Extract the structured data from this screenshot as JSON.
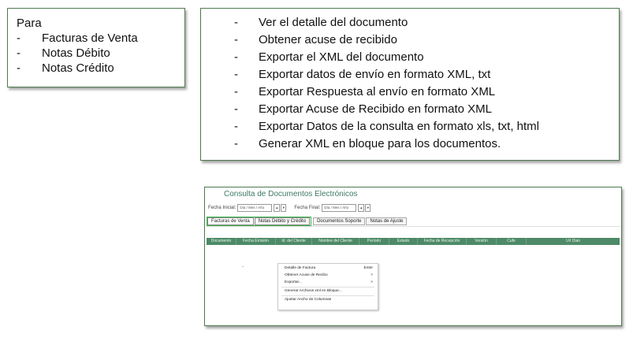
{
  "left_box": {
    "intro": "Para",
    "items": [
      "Facturas de Venta",
      "Notas Débito",
      "Notas Crédito"
    ]
  },
  "right_box": {
    "items": [
      "Ver el detalle del documento",
      "Obtener acuse de recibido",
      "Exportar el XML del documento",
      "Exportar datos de envío en formato XML, txt",
      "Exportar Respuesta al envío en formato XML",
      "Exportar Acuse de Recibido en formato XML",
      "Exportar Datos de la consulta en formato xls, txt, html",
      "Generar XML en bloque para los documentos."
    ]
  },
  "app": {
    "title": "Consulta de Documentos Electrónicos",
    "fecha_inicial_label": "Fecha Inicial:",
    "fecha_final_label": "Fecha Final:",
    "date_placeholder": "Día / Mes / Año",
    "tabs": [
      "Facturas de Venta",
      "Notas Débito y Crédito",
      "Documentos Soporte",
      "Notas de Ajuste"
    ],
    "columns": [
      "Documento",
      "Fecha Emisión",
      "Id. del Cliente",
      "Nombre del Cliente",
      "Periodo",
      "Estado",
      "Fecha de Recepción",
      "Versión",
      "Cufe",
      "Url Dian"
    ],
    "context_menu": [
      {
        "label": "Detalle de Factura",
        "shortcut": "Enter"
      },
      {
        "label": "Obtener Acuse de Recibo",
        "shortcut": ">"
      },
      {
        "label": "Exportar...",
        "shortcut": ">"
      },
      {
        "label": "Generar Archivos xml en Bloque...",
        "shortcut": ""
      },
      {
        "label": "Ajustar Ancho de Columnas",
        "shortcut": ""
      }
    ],
    "header_color": "#4e8a67",
    "tab_highlight_color": "#38b24a"
  }
}
